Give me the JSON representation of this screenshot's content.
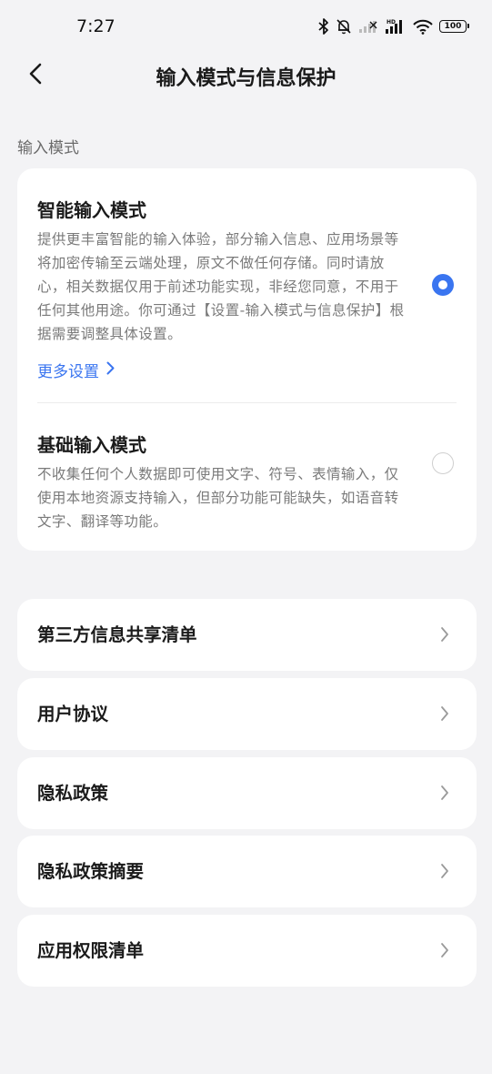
{
  "status_bar": {
    "time": "7:27",
    "battery": "100",
    "icons": [
      "bluetooth-icon",
      "bell-muted-icon",
      "signal-icon",
      "hd-signal-icon",
      "wifi-icon",
      "battery-icon"
    ]
  },
  "header": {
    "back_icon": "chevron-left-icon",
    "title": "输入模式与信息保护"
  },
  "input_mode": {
    "section_label": "输入模式",
    "smart": {
      "title": "智能输入模式",
      "description": "提供更丰富智能的输入体验，部分输入信息、应用场景等将加密传输至云端处理，原文不做任何存储。同时请放心，相关数据仅用于前述功能实现，非经您同意，不用于任何其他用途。你可通过【设置-输入模式与信息保护】根据需要调整具体设置。",
      "more_settings": "更多设置",
      "selected": true
    },
    "basic": {
      "title": "基础输入模式",
      "description": "不收集任何个人数据即可使用文字、符号、表情输入，仅使用本地资源支持输入，但部分功能可能缺失，如语音转文字、翻译等功能。",
      "selected": false
    }
  },
  "links": [
    {
      "label": "第三方信息共享清单"
    },
    {
      "label": "用户协议"
    },
    {
      "label": "隐私政策"
    },
    {
      "label": "隐私政策摘要"
    },
    {
      "label": "应用权限清单"
    }
  ],
  "colors": {
    "accent": "#3a75f0",
    "background": "#f3f3f5",
    "card": "#ffffff"
  }
}
